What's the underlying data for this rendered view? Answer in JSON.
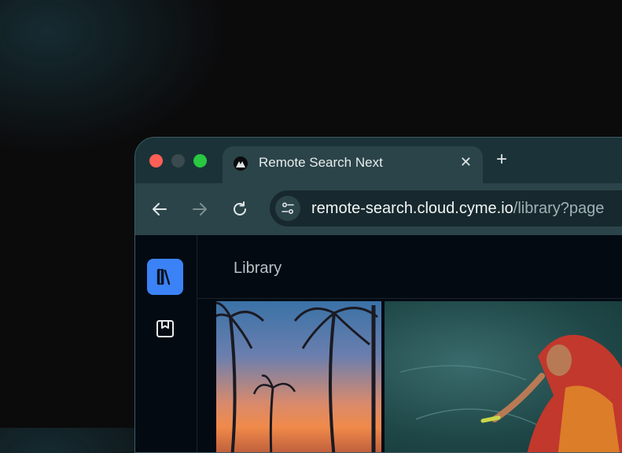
{
  "browser": {
    "tab": {
      "title": "Remote Search Next",
      "favicon": "app-logo-icon",
      "close_icon": "close-icon",
      "close_glyph": "✕"
    },
    "new_tab_glyph": "+",
    "nav": {
      "back_icon": "arrow-left-icon",
      "forward_icon": "arrow-right-icon",
      "reload_icon": "reload-icon"
    },
    "address_bar": {
      "site_info_icon": "tune-icon",
      "url_host": "remote-search.cloud.cyme.io",
      "url_path": "/library?page"
    }
  },
  "sidebar": {
    "items": [
      {
        "name": "library",
        "icon": "books-icon",
        "active": true
      },
      {
        "name": "bookmarks",
        "icon": "bookmark-icon",
        "active": false
      }
    ]
  },
  "main": {
    "title": "Library",
    "thumbnails": [
      {
        "subject": "palm-trees-sunset"
      },
      {
        "subject": "woman-in-red-sari-by-river"
      }
    ]
  },
  "colors": {
    "window_chrome": "#2b4449",
    "page_background": "#030a12",
    "accent": "#3b82f6",
    "traffic_red": "#ff5f57",
    "traffic_green": "#28c840"
  }
}
